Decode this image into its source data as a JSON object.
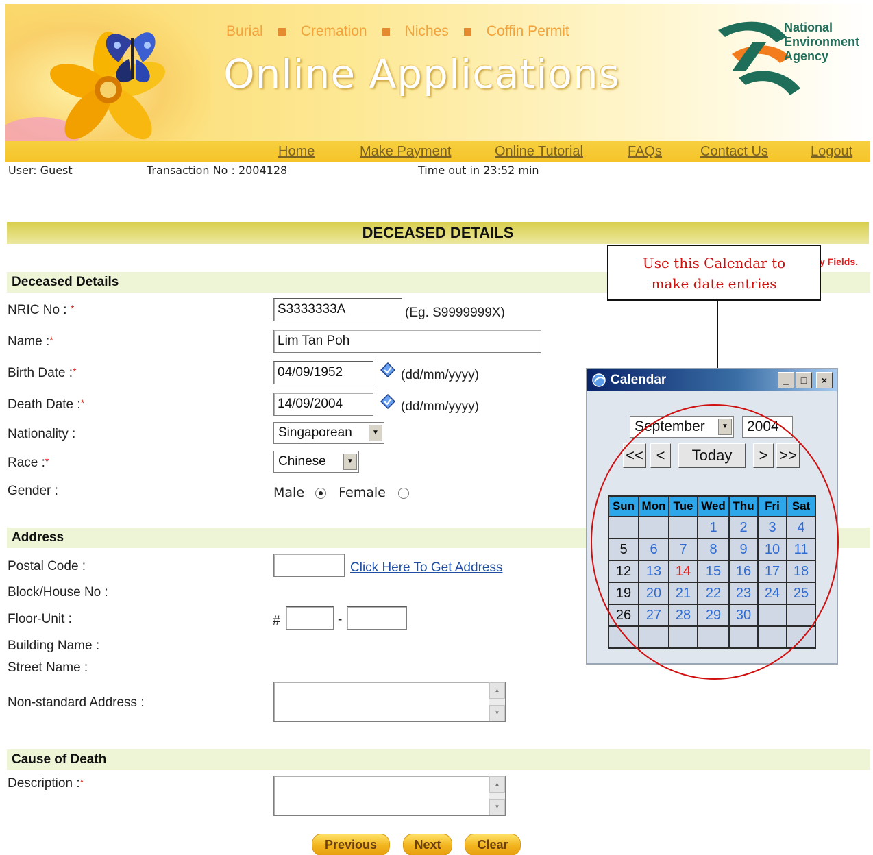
{
  "banner": {
    "top_links": [
      "Burial",
      "Cremation",
      "Niches",
      "Coffin Permit"
    ],
    "title": "Online Applications",
    "agency_lines": [
      "National",
      "Environment",
      "Agency"
    ]
  },
  "nav": {
    "items": [
      "Home",
      "Make Payment",
      "Online Tutorial",
      "FAQs",
      "Contact Us",
      "Logout"
    ]
  },
  "session": {
    "user": "User: Guest",
    "transaction": "Transaction No : 2004128",
    "timeout": "Time out in 23:52 min"
  },
  "page_title": "DECEASED DETAILS",
  "mandatory_note": "y Fields.",
  "sections": {
    "deceased": "Deceased Details",
    "address": "Address",
    "cause": "Cause of Death"
  },
  "labels": {
    "nric": "NRIC No :",
    "name": "Name :",
    "birth": "Birth Date :",
    "death": "Death Date :",
    "nationality": "Nationality :",
    "race": "Race :",
    "gender": "Gender :",
    "postal": "Postal Code :",
    "block": "Block/House No :",
    "floor": "Floor-Unit :",
    "building": "Building Name :",
    "street": "Street Name :",
    "nonstd": "Non-standard Address :",
    "description": "Description :",
    "required_mark": "*"
  },
  "values": {
    "nric": "S3333333A",
    "name": "Lim Tan Poh",
    "birth": "04/09/1952",
    "death": "14/09/2004",
    "nationality": "Singaporean",
    "race": "Chinese",
    "postal": "",
    "floor": "",
    "unit": "",
    "nonstd": "",
    "description": ""
  },
  "hints": {
    "nric": "(Eg. S9999999X)",
    "date": "(dd/mm/yyyy)",
    "floor_prefix": "#",
    "floor_sep": "-"
  },
  "gender": {
    "male": "Male",
    "female": "Female",
    "selected": "Male"
  },
  "get_address_link": "Click Here To Get Address",
  "buttons": {
    "previous": "Previous",
    "next": "Next",
    "clear": "Clear"
  },
  "annotation": {
    "line1": "Use this Calendar to",
    "line2": "make date entries"
  },
  "calendar": {
    "window_title": "Calendar",
    "window_buttons": [
      "_",
      "□",
      "×"
    ],
    "month": "September",
    "year": "2004",
    "nav": {
      "prev_year": "<<",
      "prev_month": "<",
      "today": "Today",
      "next_month": ">",
      "next_year": ">>"
    },
    "weekdays": [
      "Sun",
      "Mon",
      "Tue",
      "Wed",
      "Thu",
      "Fri",
      "Sat"
    ],
    "weeks": [
      [
        "",
        "",
        "",
        "1",
        "2",
        "3",
        "4"
      ],
      [
        "5",
        "6",
        "7",
        "8",
        "9",
        "10",
        "11"
      ],
      [
        "12",
        "13",
        "14",
        "15",
        "16",
        "17",
        "18"
      ],
      [
        "19",
        "20",
        "21",
        "22",
        "23",
        "24",
        "25"
      ],
      [
        "26",
        "27",
        "28",
        "29",
        "30",
        "",
        ""
      ],
      [
        "",
        "",
        "",
        "",
        "",
        "",
        ""
      ]
    ],
    "highlight_day": "14"
  },
  "colors": {
    "nav_bar": "#f5c42a",
    "section_band": "#eef5d6",
    "header_band": "#d8cf4c",
    "required": "#e02020",
    "annotation_red": "#cc1111",
    "calendar_header": "#2ea7ea",
    "calendar_day": "#2f6bd0"
  }
}
